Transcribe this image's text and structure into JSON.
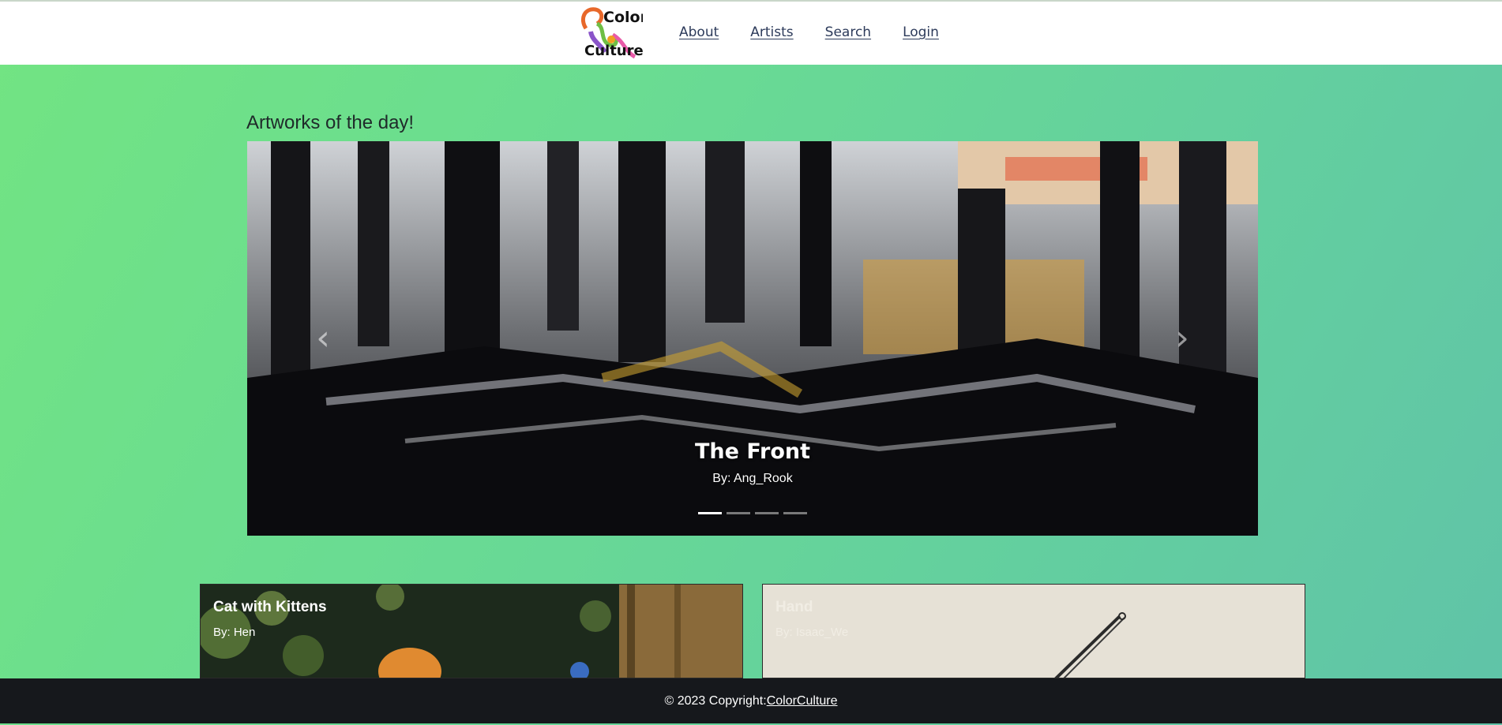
{
  "header": {
    "logo_text_top": "Color",
    "logo_text_bottom": "Culture",
    "nav": [
      {
        "label": "About"
      },
      {
        "label": "Artists"
      },
      {
        "label": "Search"
      },
      {
        "label": "Login"
      }
    ]
  },
  "main": {
    "section_title": "Artworks of the day!",
    "carousel": {
      "prev_icon": "chevron-left-icon",
      "next_icon": "chevron-right-icon",
      "prev_glyph": "‹",
      "next_glyph": "›",
      "slide_count": 4,
      "active_slide": 1,
      "current": {
        "title": "The Front",
        "artist": "By: Ang_Rook"
      }
    },
    "cards": [
      {
        "title": "Cat with Kittens",
        "artist": "By: Hen"
      },
      {
        "title": "Hand",
        "artist": "By: Isaac_We"
      }
    ]
  },
  "footer": {
    "copyright": "© 2023 Copyright:",
    "link": "ColorCulture"
  },
  "colors": {
    "header_bg": "#ffffff",
    "nav_text": "#2c3a5a",
    "gradient_start": "#72e482",
    "gradient_end": "#60c3a8",
    "footer_bg": "#16181c"
  }
}
